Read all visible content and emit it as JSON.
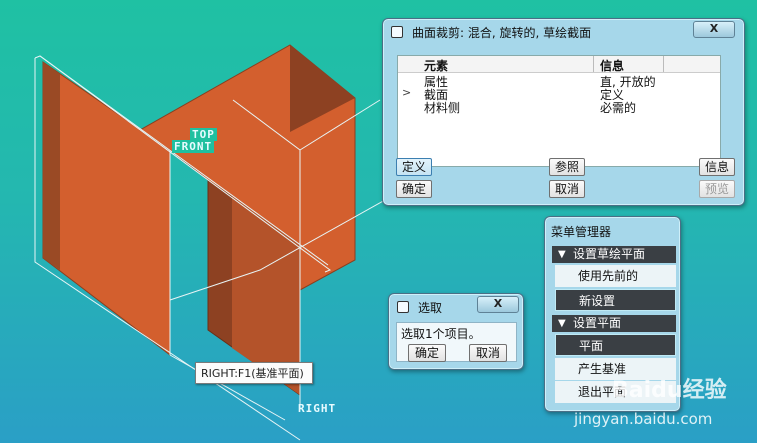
{
  "viewport": {
    "labels": {
      "top": "TOP",
      "front": "FRONT",
      "right": "RIGHT"
    },
    "tooltip": "RIGHT:F1(基准平面)",
    "colors": {
      "surface": "#d35f2e",
      "surface_dark": "#8d4122",
      "datum": "#e8f4f5"
    }
  },
  "main_dialog": {
    "title": "曲面裁剪: 混合, 旋转的, 草绘截面",
    "close": "X",
    "columns": [
      "元素",
      "信息"
    ],
    "rows": [
      {
        "marker": "",
        "element": "属性",
        "info": "直, 开放的"
      },
      {
        "marker": ">",
        "element": "截面",
        "info": "定义"
      },
      {
        "marker": "",
        "element": "材料侧",
        "info": "必需的"
      }
    ],
    "buttons": {
      "define": "定义",
      "reference": "参照",
      "info": "信息",
      "ok": "确定",
      "cancel": "取消",
      "preview": "预览"
    }
  },
  "select_dialog": {
    "title": "选取",
    "close": "X",
    "message": "选取1个项目。",
    "buttons": {
      "ok": "确定",
      "cancel": "取消"
    }
  },
  "menu_manager": {
    "title": "菜单管理器",
    "sections": [
      {
        "label": "设置草绘平面",
        "items": [
          {
            "label": "使用先前的",
            "selected": false
          },
          {
            "label": "新设置",
            "selected": true
          }
        ]
      },
      {
        "label": "设置平面",
        "items": [
          {
            "label": "平面",
            "selected": true
          },
          {
            "label": "产生基准",
            "selected": false
          },
          {
            "label": "退出平面",
            "selected": false
          }
        ]
      }
    ]
  },
  "watermark": {
    "brand": "Baidu经验",
    "url": "jingyan.baidu.com"
  }
}
